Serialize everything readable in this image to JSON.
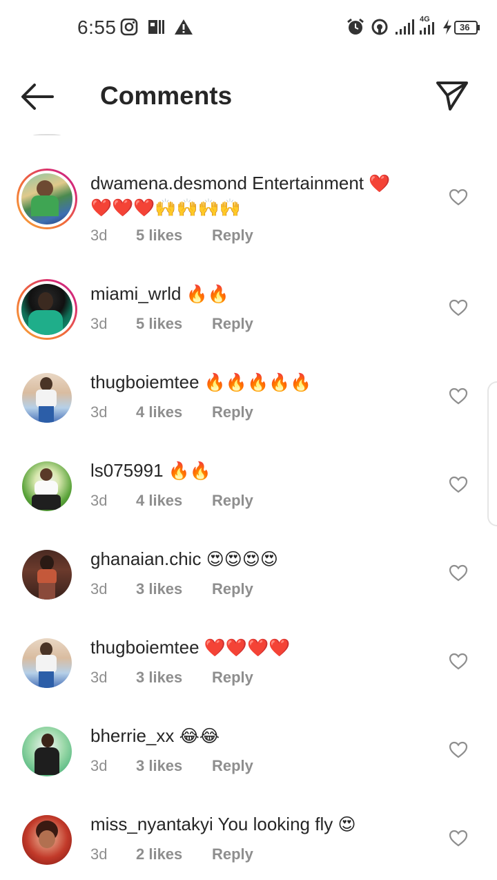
{
  "status_bar": {
    "time": "6:55",
    "battery": "36",
    "network": "4G"
  },
  "header": {
    "title": "Comments",
    "back_icon": "arrow-left-icon",
    "share_icon": "paper-plane-icon"
  },
  "comments": [
    {
      "username": "dwamena.desmond",
      "text": "Entertainment",
      "emoji_line1": "❤️",
      "emoji_line2": "❤️❤️❤️🙌🙌🙌🙌",
      "time": "3d",
      "likes": "5 likes",
      "reply": "Reply",
      "has_story": true
    },
    {
      "username": "miami_wrld",
      "text": "",
      "emoji": "🔥🔥",
      "time": "3d",
      "likes": "5 likes",
      "reply": "Reply",
      "has_story": true
    },
    {
      "username": "thugboiemtee",
      "text": "",
      "emoji": "🔥🔥🔥🔥🔥",
      "time": "3d",
      "likes": "4 likes",
      "reply": "Reply",
      "has_story": false
    },
    {
      "username": "ls075991",
      "text": "",
      "emoji": "🔥🔥",
      "time": "3d",
      "likes": "4 likes",
      "reply": "Reply",
      "has_story": false
    },
    {
      "username": "ghanaian.chic",
      "text": "",
      "emoji": "😍😍😍😍",
      "time": "3d",
      "likes": "3 likes",
      "reply": "Reply",
      "has_story": false
    },
    {
      "username": "thugboiemtee",
      "text": "",
      "emoji": "❤️❤️❤️❤️",
      "time": "3d",
      "likes": "3 likes",
      "reply": "Reply",
      "has_story": false
    },
    {
      "username": "bherrie_xx",
      "text": "",
      "emoji": "😂😂",
      "time": "3d",
      "likes": "3 likes",
      "reply": "Reply",
      "has_story": false
    },
    {
      "username": "miss_nyantakyi",
      "text": "You looking fly",
      "emoji": "😍",
      "time": "3d",
      "likes": "2 likes",
      "reply": "Reply",
      "has_story": false
    }
  ],
  "like_icon": "heart-outline-icon"
}
